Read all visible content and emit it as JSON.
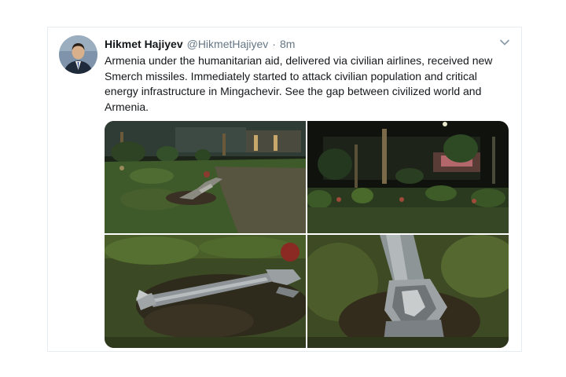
{
  "tweet": {
    "author_name": "Hikmet Hajiyev",
    "handle": "@HikmetHajiyev",
    "separator": "·",
    "time": "8m",
    "text": "Armenia under the humanitarian aid, delivered via civilian airlines, received new Smerch missiles. Immediately started to attack civilian population and critical energy infrastructure in Mingachevir. See the gap between civilized world and Armenia."
  },
  "icons": {
    "menu": "chevron-down-icon"
  },
  "colors": {
    "text": "#14171a",
    "secondary": "#657786",
    "border": "#e6ecf0"
  }
}
